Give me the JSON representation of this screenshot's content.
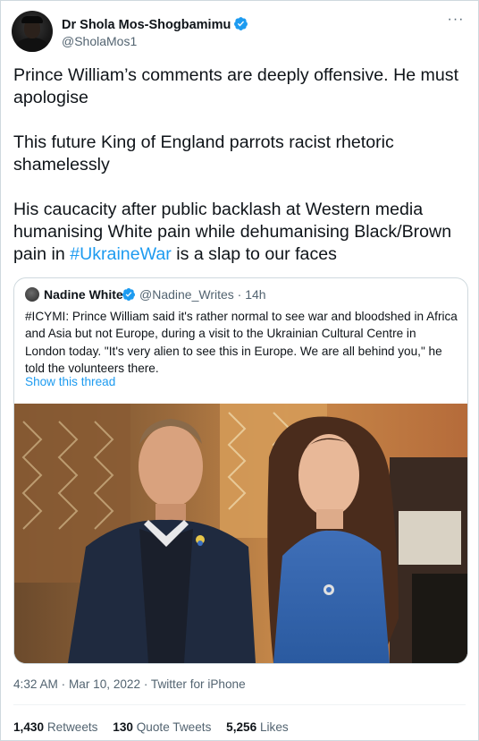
{
  "author": {
    "name": "Dr Shola Mos-Shogbamimu",
    "handle": "@SholaMos1"
  },
  "tweet": {
    "paragraphs": [
      "Prince William’s comments are deeply offensive. He must apologise",
      "This future King of England parrots racist rhetoric shamelessly"
    ],
    "last_paragraph_before": "His caucacity after public backlash at Western media humanising White pain while dehumanising Black/Brown pain in ",
    "hashtag": "#UkraineWar",
    "last_paragraph_after": " is a slap to our faces"
  },
  "quote": {
    "name": "Nadine White",
    "handle_time": "@Nadine_Writes · 14h",
    "text": "#ICYMI: Prince William said it's rather normal to see war and bloodshed in Africa and Asia but not Europe, during a visit to the Ukrainian Cultural Centre in London today. \"It's very alien to see this in Europe. We are all behind you,\" he told the volunteers there.",
    "show_thread": "Show this thread"
  },
  "meta": "4:32 AM · Mar 10, 2022 · Twitter for iPhone",
  "stats": {
    "retweets_count": "1,430",
    "retweets_label": "Retweets",
    "quotes_count": "130",
    "quotes_label": "Quote Tweets",
    "likes_count": "5,256",
    "likes_label": "Likes"
  },
  "colors": {
    "link": "#1d9bf0",
    "secondary_text": "#536471",
    "primary_text": "#0f1419",
    "border": "#cfd9de"
  }
}
